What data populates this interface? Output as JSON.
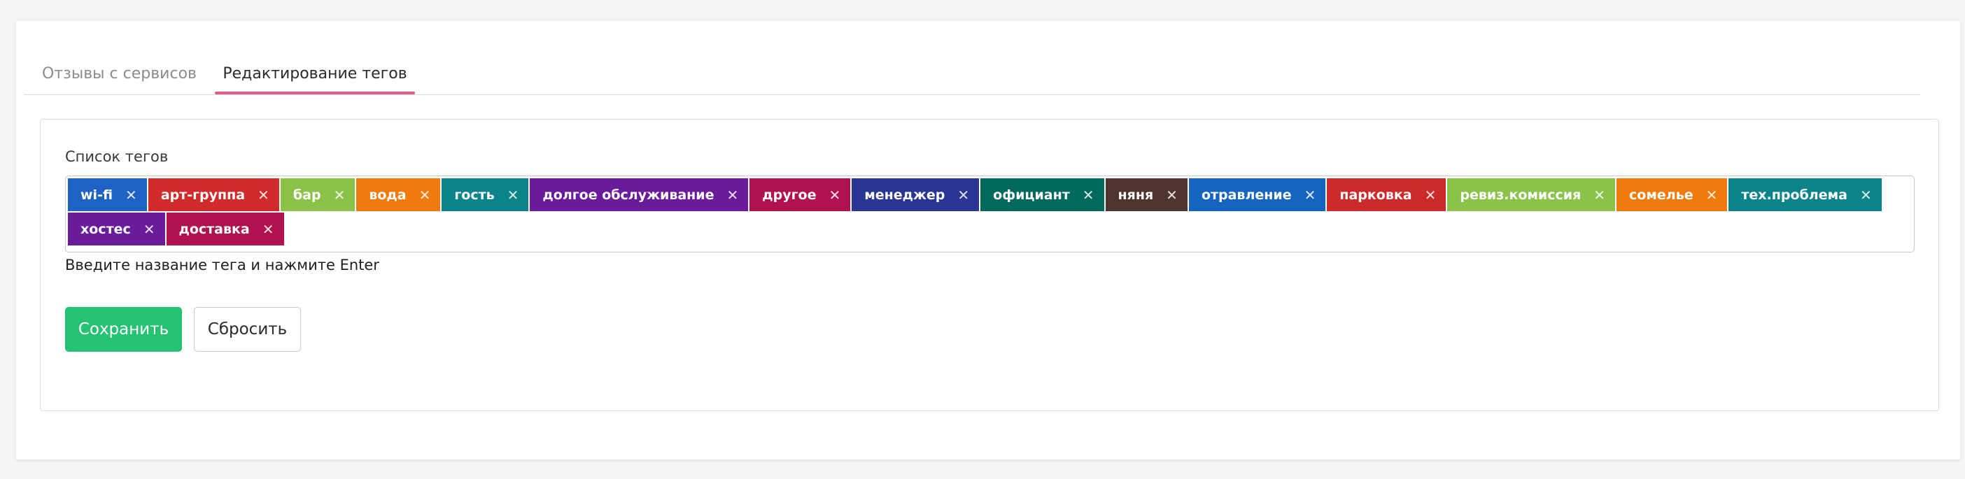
{
  "tabs": [
    {
      "label": "Отзывы с сервисов",
      "active": false
    },
    {
      "label": "Редактирование тегов",
      "active": true
    }
  ],
  "accent_color": "#e8578a",
  "form": {
    "label": "Список тегов",
    "hint": "Введите название тега и нажмите Enter",
    "remove_icon": "close-icon"
  },
  "tags": [
    {
      "label": "wi-fi",
      "color": "#1e63c4"
    },
    {
      "label": "арт-группа",
      "color": "#d12a2a"
    },
    {
      "label": "бар",
      "color": "#8bc34a"
    },
    {
      "label": "вода",
      "color": "#f07b0c"
    },
    {
      "label": "гость",
      "color": "#0b8489"
    },
    {
      "label": "долгое обслуживание",
      "color": "#6a1b9a"
    },
    {
      "label": "другое",
      "color": "#b0124f"
    },
    {
      "label": "менеджер",
      "color": "#283593"
    },
    {
      "label": "официант",
      "color": "#00695c"
    },
    {
      "label": "няня",
      "color": "#4e342e"
    },
    {
      "label": "отравление",
      "color": "#1565c0"
    },
    {
      "label": "парковка",
      "color": "#cc2a2a"
    },
    {
      "label": "ревиз.комиссия",
      "color": "#8bc34a"
    },
    {
      "label": "сомелье",
      "color": "#f07b0c"
    },
    {
      "label": "тех.проблема",
      "color": "#0b8489"
    },
    {
      "label": "хостес",
      "color": "#6a1b9a"
    },
    {
      "label": "доставка",
      "color": "#b0124f"
    }
  ],
  "buttons": {
    "save_label": "Сохранить",
    "save_color": "#26c274",
    "reset_label": "Сбросить"
  }
}
